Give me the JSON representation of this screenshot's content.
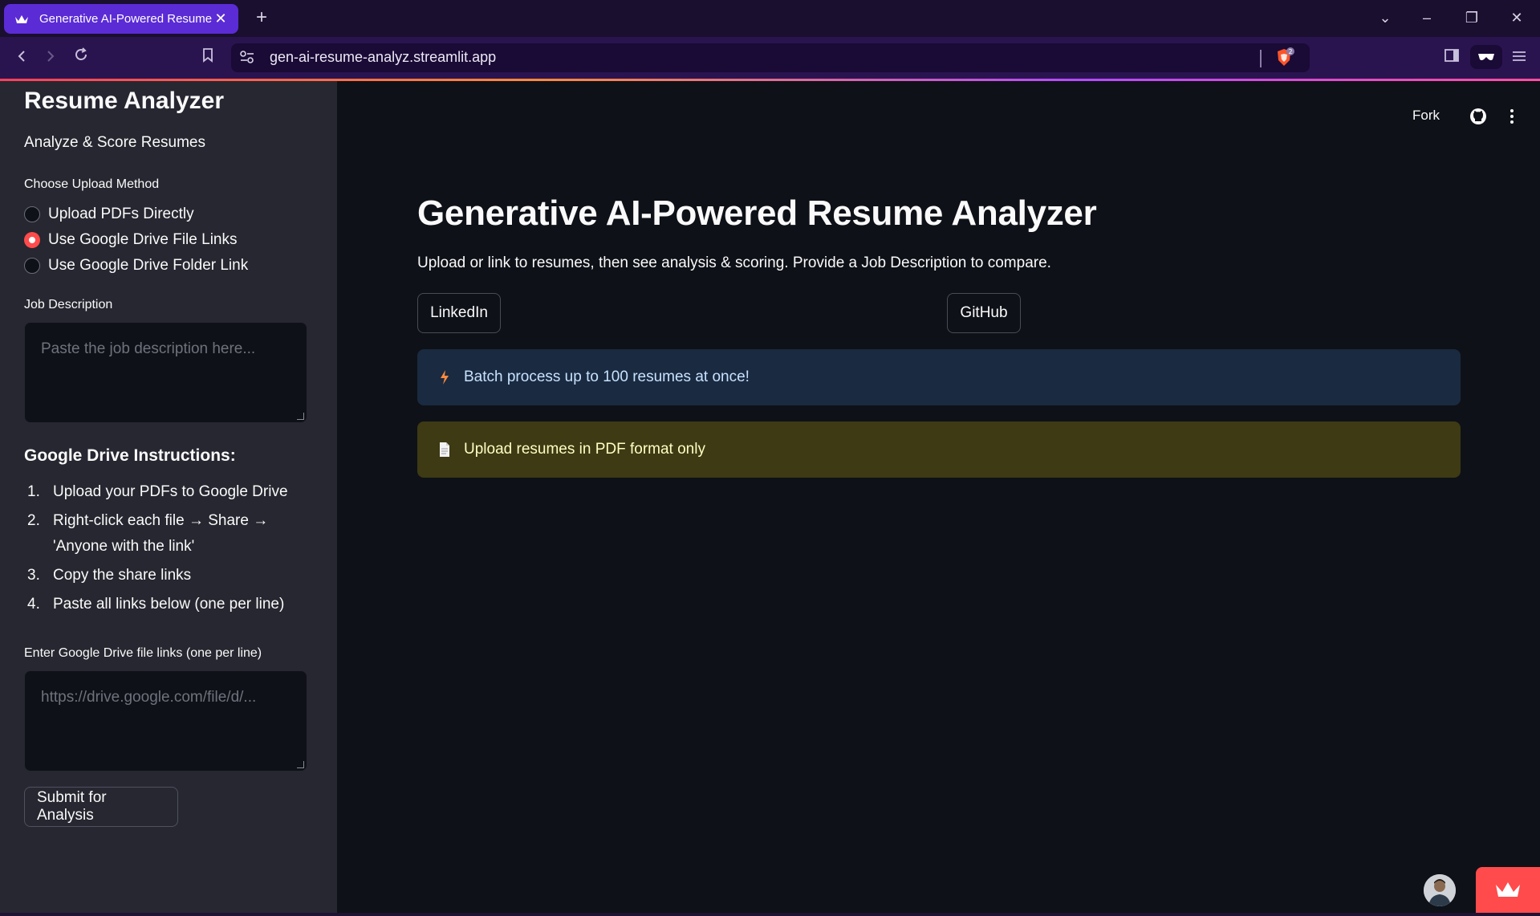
{
  "browser": {
    "tab_title": "Generative AI-Powered Resume Analyzer",
    "tab_close": "✕",
    "new_tab": "+",
    "url": "gen-ai-resume-analyz.streamlit.app",
    "shield_count": "2"
  },
  "sidebar": {
    "title": "Resume Analyzer",
    "subtitle": "Analyze & Score Resumes",
    "upload_method_label": "Choose Upload Method",
    "options": [
      {
        "label": "Upload PDFs Directly",
        "selected": false
      },
      {
        "label": "Use Google Drive File Links",
        "selected": true
      },
      {
        "label": "Use Google Drive Folder Link",
        "selected": false
      }
    ],
    "job_description_label": "Job Description",
    "job_description_placeholder": "Paste the job description here...",
    "instructions_heading": "Google Drive Instructions:",
    "instructions": [
      {
        "num": "1.",
        "text": "Upload your PDFs to Google Drive"
      },
      {
        "num": "2.",
        "text": "Right-click each file → Share → 'Anyone with the link'"
      },
      {
        "num": "3.",
        "text": "Copy the share links"
      },
      {
        "num": "4.",
        "text": "Paste all links below (one per line)"
      }
    ],
    "links_label": "Enter Google Drive file links (one per line)",
    "links_placeholder": "https://drive.google.com/file/d/...",
    "submit_label": "Submit for Analysis"
  },
  "header": {
    "fork_label": "Fork"
  },
  "main": {
    "title": "Generative AI-Powered Resume Analyzer",
    "lead": "Upload or link to resumes, then see analysis & scoring. Provide a Job Description to compare.",
    "linkedin_label": "LinkedIn",
    "github_label": "GitHub",
    "info_text": "Batch process up to 100 resumes at once!",
    "warning_text": "Upload resumes in PDF format only"
  },
  "colors": {
    "accent": "#ff4b4b",
    "sidebar_bg": "#262730",
    "main_bg": "#0e1117",
    "info_bg": "#1a2a40",
    "warning_bg": "#3d3a14"
  }
}
